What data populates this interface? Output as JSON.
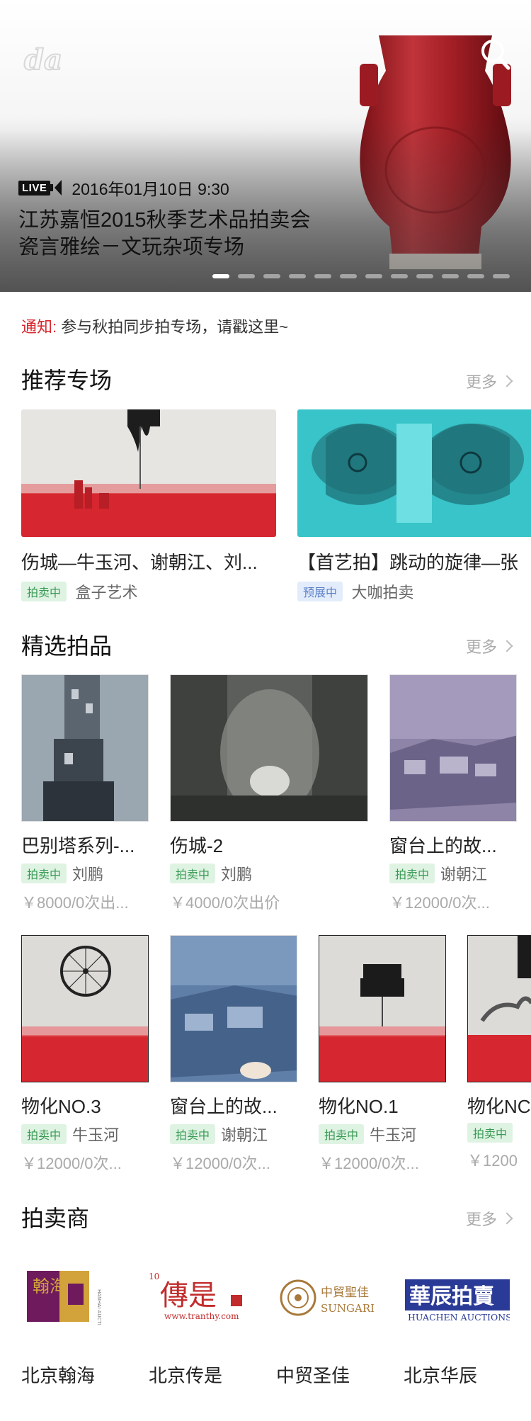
{
  "hero": {
    "live_label": "LIVE",
    "date": "2016年01月10日 9:30",
    "title_line1": "江苏嘉恒2015秋季艺术品拍卖会",
    "title_line2": "瓷言雅绘－文玩杂项专场",
    "slide_count": 12,
    "active_slide": 1
  },
  "notice": {
    "label": "通知:",
    "text": "参与秋拍同步拍专场，请戳这里~"
  },
  "recommended": {
    "title": "推荐专场",
    "more": "更多",
    "items": [
      {
        "name": "伤城—牛玉河、谢朝江、刘...",
        "status": "拍卖中",
        "status_color": "green",
        "org": "盒子艺术"
      },
      {
        "name": "【首艺拍】跳动的旋律—张",
        "status": "预展中",
        "status_color": "blue",
        "org": "大咖拍卖"
      }
    ]
  },
  "lots": {
    "title": "精选拍品",
    "more": "更多",
    "row1": [
      {
        "name": "巴别塔系列-...",
        "status": "拍卖中",
        "artist": "刘鹏",
        "price": "￥8000/0次出..."
      },
      {
        "name": "伤城-2",
        "status": "拍卖中",
        "artist": "刘鹏",
        "price": "￥4000/0次出价"
      },
      {
        "name": "窗台上的故...",
        "status": "拍卖中",
        "artist": "谢朝江",
        "price": "￥12000/0次..."
      }
    ],
    "row2": [
      {
        "name": "物化NO.3",
        "status": "拍卖中",
        "artist": "牛玉河",
        "price": "￥12000/0次..."
      },
      {
        "name": "窗台上的故...",
        "status": "拍卖中",
        "artist": "谢朝江",
        "price": "￥12000/0次..."
      },
      {
        "name": "物化NO.1",
        "status": "拍卖中",
        "artist": "牛玉河",
        "price": "￥12000/0次..."
      },
      {
        "name": "物化NC",
        "status": "拍卖中",
        "artist": "",
        "price": "￥1200"
      }
    ]
  },
  "auctioneers": {
    "title": "拍卖商",
    "more": "更多",
    "items": [
      {
        "name": "北京翰海",
        "logo_text": "翰海",
        "logo_sub": "HANHAI AUCTION"
      },
      {
        "name": "北京传是",
        "logo_text": "傳是",
        "logo_sub": "www.tranthy.com"
      },
      {
        "name": "中贸圣佳",
        "logo_text": "中貿聖佳",
        "logo_sub": "SUNGARI"
      },
      {
        "name": "北京华辰",
        "logo_text": "華辰拍賣",
        "logo_sub": "HUACHEN AUCTIONS"
      }
    ]
  },
  "colors": {
    "accent_red": "#d9262e",
    "tag_green": "#3a9a55",
    "tag_blue": "#5a80c8"
  }
}
